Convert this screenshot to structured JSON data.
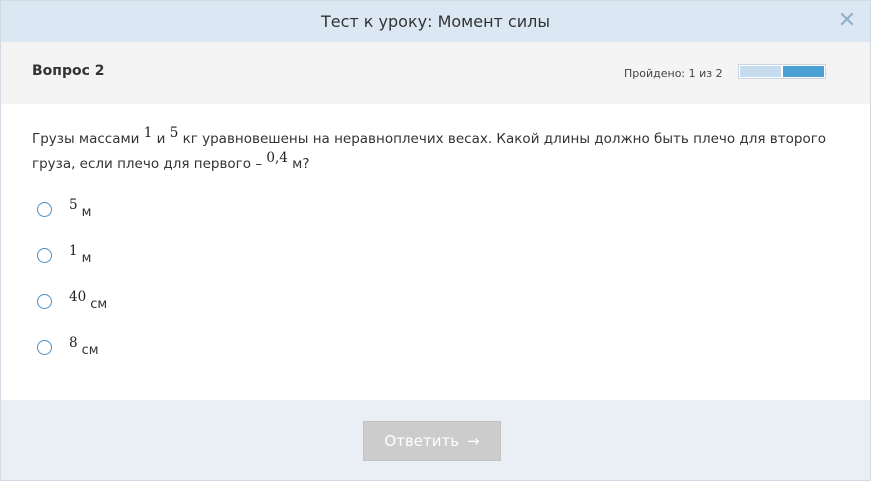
{
  "header": {
    "title": "Тест к уроку: Момент силы",
    "close_glyph": "✕"
  },
  "subheader": {
    "question_label": "Вопрос 2",
    "progress_text": "Пройдено: 1 из 2",
    "progress": {
      "done": 1,
      "total": 2
    },
    "progress_colors": {
      "done": "#c5dcef",
      "current": "#4a9fd4"
    }
  },
  "question": {
    "part1": "Грузы массами ",
    "m1": "1",
    "part2": " и ",
    "m2": "5",
    "part3": " кг уравновешены на неравноплечих весах. Какой длины должно быть плечо для второго груза, если плечо для первого – ",
    "l1": "0,4",
    "part4": " м?"
  },
  "options": [
    {
      "value": "5",
      "unit": "м"
    },
    {
      "value": "1",
      "unit": "м"
    },
    {
      "value": "40",
      "unit": "см"
    },
    {
      "value": "8",
      "unit": "см"
    }
  ],
  "footer": {
    "submit_label": "Ответить",
    "submit_arrow": "→"
  }
}
